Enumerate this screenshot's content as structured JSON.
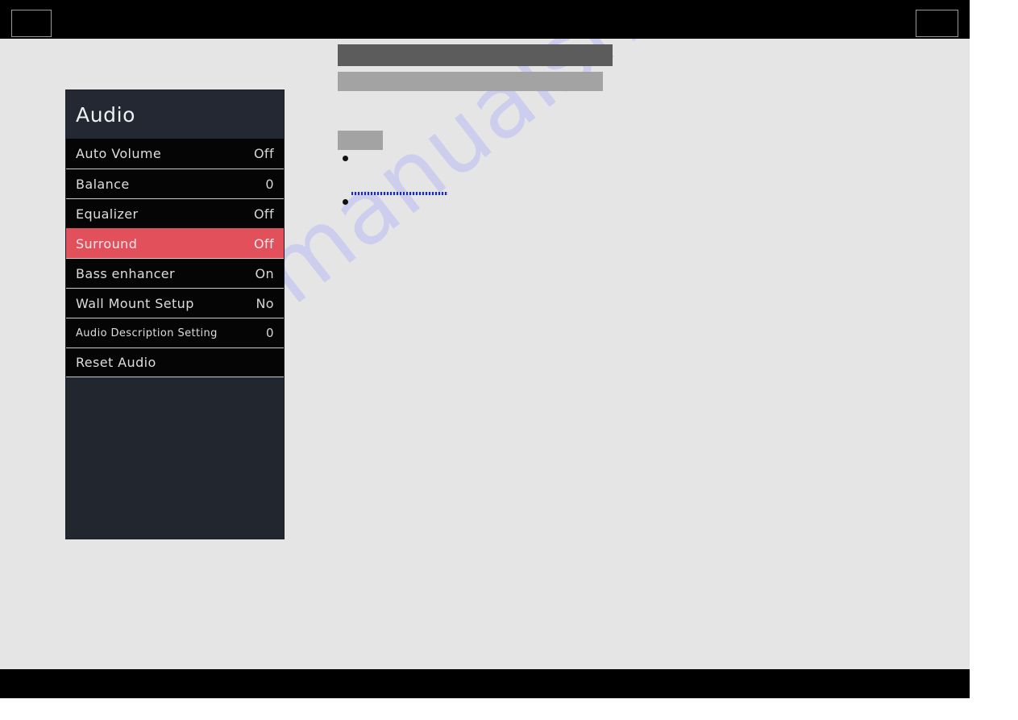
{
  "page": {
    "background_color": "#e5e5e5",
    "watermark_text": "manualshive.com",
    "watermark_color": "#c9c9ef"
  },
  "header_band": {
    "background_color": "#000000",
    "left_box_label": "",
    "right_box_label": ""
  },
  "footer_band": {
    "background_color": "#000000"
  },
  "redacted": {
    "headline_color": "#5c5c5c",
    "subline_color": "#a3a3a3",
    "chip_color": "#a3a3a3",
    "link_color": "#1f2d9e"
  },
  "osd": {
    "title": "Audio",
    "panel_color": "#21262f",
    "row_color": "#050505",
    "highlight_color": "#e2505c",
    "items": [
      {
        "label": "Auto Volume",
        "value": "Off",
        "selected": false,
        "small": false
      },
      {
        "label": "Balance",
        "value": "0",
        "selected": false,
        "small": false
      },
      {
        "label": "Equalizer",
        "value": "Off",
        "selected": false,
        "small": false
      },
      {
        "label": "Surround",
        "value": "Off",
        "selected": true,
        "small": false
      },
      {
        "label": "Bass enhancer",
        "value": "On",
        "selected": false,
        "small": false
      },
      {
        "label": "Wall Mount Setup",
        "value": "No",
        "selected": false,
        "small": false
      },
      {
        "label": "Audio Description Setting",
        "value": "0",
        "selected": false,
        "small": true
      },
      {
        "label": "Reset Audio",
        "value": "",
        "selected": false,
        "small": false
      }
    ]
  }
}
